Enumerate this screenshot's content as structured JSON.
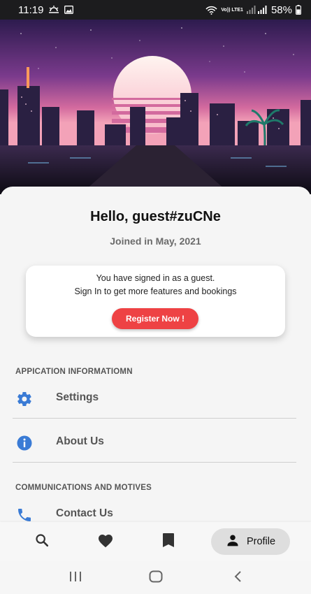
{
  "status_bar": {
    "time": "11:19",
    "network_label": "Vo)) LTE1",
    "battery": "58%",
    "icons": [
      "weather-icon",
      "image-icon",
      "wifi-icon",
      "signal-icon",
      "battery-icon"
    ]
  },
  "profile": {
    "greeting": "Hello, guest#zuCNe",
    "joined": "Joined in May, 2021"
  },
  "guest_card": {
    "line1": "You have signed in as a guest.",
    "line2": "Sign In to get more features and bookings",
    "register_label": "Register Now !"
  },
  "sections": [
    {
      "title": "APPICATION INFORMATIOMN",
      "items": [
        {
          "label": "Settings",
          "icon": "gear-icon"
        },
        {
          "label": "About Us",
          "icon": "info-icon"
        }
      ]
    },
    {
      "title": "COMMUNICATIONS AND MOTIVES",
      "items": [
        {
          "label": "Contact Us",
          "icon": "phone-icon"
        }
      ]
    }
  ],
  "bottom_nav": {
    "items": [
      "search-icon",
      "heart-icon",
      "bookmark-icon"
    ],
    "active_label": "Profile"
  },
  "system_nav": [
    "recents-icon",
    "home-icon",
    "back-icon"
  ],
  "colors": {
    "accent_red": "#ee4244",
    "icon_blue": "#3a7bd5",
    "status_bar": "#1c1c1e"
  }
}
